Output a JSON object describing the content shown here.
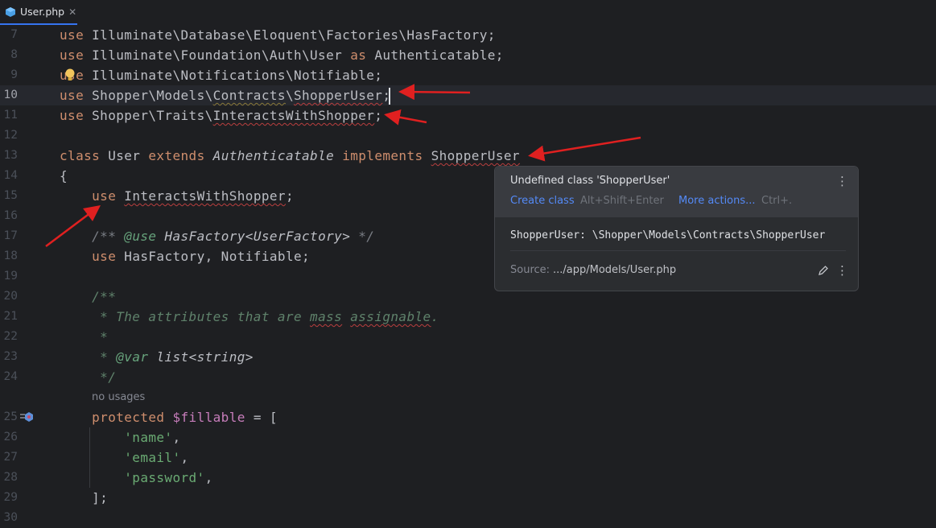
{
  "tab": {
    "label": "User.php",
    "icon": "php-file-icon",
    "close": "✕"
  },
  "lines": [
    {
      "n": "7",
      "html": "<span class=\"kw\">use</span> Illuminate\\Database\\Eloquent\\Factories\\HasFactory;"
    },
    {
      "n": "8",
      "html": "<span class=\"kw\">use</span> Illuminate\\Foundation\\Auth\\User <span class=\"kw\">as</span> Authenticatable;"
    },
    {
      "n": "9",
      "html": "<span class=\"kw\">use</span> Illuminate\\Notifications\\Notifiable;"
    },
    {
      "n": "10",
      "html": "<span class=\"kw\">use</span> Shopper\\Models\\<span class=\"wavyg\">Contracts</span>\\<span class=\"wavy\">ShopperUser</span>;",
      "current": true
    },
    {
      "n": "11",
      "html": "<span class=\"kw\">use</span> Shopper\\Traits\\<span class=\"wavy\">InteractsWithShopper</span>;"
    },
    {
      "n": "12",
      "html": ""
    },
    {
      "n": "13",
      "html": "<span class=\"kw\">class</span> User <span class=\"kw\">extends</span> <span class=\"it\">Authenticatable</span> <span class=\"kw\">implements</span> <span class=\"wavy\">ShopperUser</span>"
    },
    {
      "n": "14",
      "html": "{"
    },
    {
      "n": "15",
      "html": "    <span class=\"kw\">use</span> <span class=\"wavy\">InteractsWithShopper</span>;"
    },
    {
      "n": "16",
      "html": ""
    },
    {
      "n": "17",
      "html": "    <span class=\"cm\">/** </span><span class=\"doctag\">@use</span><span class=\"cm\"> <span style=\"color:#bcbec4\">HasFactory&lt;UserFactory&gt;</span> */</span>"
    },
    {
      "n": "18",
      "html": "    <span class=\"kw\">use</span> HasFactory, Notifiable;"
    },
    {
      "n": "19",
      "html": ""
    },
    {
      "n": "20",
      "html": "    <span class=\"doc\">/**</span>"
    },
    {
      "n": "21",
      "html": "     <span class=\"doc\">* The attributes that are <span class=\"wavy\">mass</span> <span class=\"wavy\">assignable</span>.</span>"
    },
    {
      "n": "22",
      "html": "     <span class=\"doc\">*</span>"
    },
    {
      "n": "23",
      "html": "     <span class=\"doc\">* </span><span class=\"doctag\">@var</span><span class=\"doc\"> <span style=\"color:#bcbec4\">list&lt;string&gt;</span></span>"
    },
    {
      "n": "24",
      "html": "     <span class=\"doc\">*/</span>"
    },
    {
      "n": "",
      "html": "",
      "usages": "no usages"
    },
    {
      "n": "25",
      "html": "    <span class=\"kw\">protected</span> <span class=\"var\">$fillable</span> = ["
    },
    {
      "n": "26",
      "html": "        <span class=\"str\">'name'</span>,"
    },
    {
      "n": "27",
      "html": "        <span class=\"str\">'email'</span>,"
    },
    {
      "n": "28",
      "html": "        <span class=\"str\">'password'</span>,"
    },
    {
      "n": "29",
      "html": "    ];"
    },
    {
      "n": "30",
      "html": ""
    }
  ],
  "popup": {
    "title": "Undefined class 'ShopperUser'",
    "action_primary": "Create class",
    "shortcut_primary": "Alt+Shift+Enter",
    "action_secondary": "More actions...",
    "shortcut_secondary": "Ctrl+.",
    "declaration": "ShopperUser: \\Shopper\\Models\\Contracts\\ShopperUser",
    "source_label": "Source:",
    "source_path": ".../app/Models/User.php",
    "menu_icon": "more-vertical-icon",
    "edit_icon": "pencil-icon"
  },
  "colors": {
    "accent": "#3574f0",
    "error": "#ba3f3f",
    "keyword": "#cf8e6d",
    "annotation_arrow": "#e02020"
  }
}
